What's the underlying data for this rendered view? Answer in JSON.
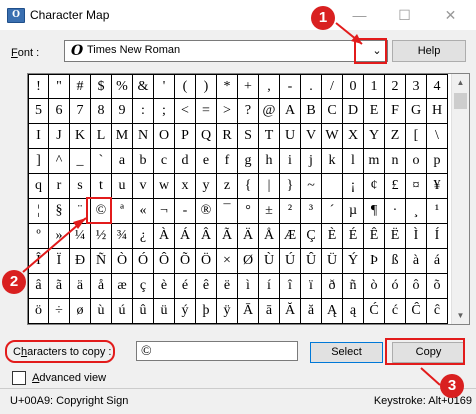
{
  "window": {
    "title": "Character Map",
    "icon": "character-map-app-icon",
    "minimize_glyph": "—",
    "maximize_glyph": "☐",
    "close_glyph": "✕"
  },
  "font": {
    "label": "Font :",
    "icon": "opentype-o-icon",
    "icon_glyph": "O",
    "value": "Times New Roman",
    "help_label": "Help"
  },
  "grid": {
    "rows": [
      [
        "!",
        "\"",
        "#",
        "$",
        "%",
        "&",
        "'",
        "(",
        ")",
        "*",
        "+",
        ",",
        "-",
        ".",
        "/",
        "0",
        "1",
        "2",
        "3",
        "4"
      ],
      [
        "5",
        "6",
        "7",
        "8",
        "9",
        ":",
        ";",
        "<",
        "=",
        ">",
        "?",
        "@",
        "A",
        "B",
        "C",
        "D",
        "E",
        "F",
        "G",
        "H"
      ],
      [
        "I",
        "J",
        "K",
        "L",
        "M",
        "N",
        "O",
        "P",
        "Q",
        "R",
        "S",
        "T",
        "U",
        "V",
        "W",
        "X",
        "Y",
        "Z",
        "[",
        "\\"
      ],
      [
        "]",
        "^",
        "_",
        "`",
        "a",
        "b",
        "c",
        "d",
        "e",
        "f",
        "g",
        "h",
        "i",
        "j",
        "k",
        "l",
        "m",
        "n",
        "o",
        "p"
      ],
      [
        "q",
        "r",
        "s",
        "t",
        "u",
        "v",
        "w",
        "x",
        "y",
        "z",
        "{",
        "|",
        "}",
        "~",
        " ",
        "¡",
        "¢",
        "£",
        "¤",
        "¥"
      ],
      [
        "¦",
        "§",
        "¨",
        "©",
        "ª",
        "«",
        "¬",
        "-",
        "®",
        "¯",
        "°",
        "±",
        "²",
        "³",
        "´",
        "µ",
        "¶",
        "·",
        "¸",
        "¹"
      ],
      [
        "º",
        "»",
        "¼",
        "½",
        "¾",
        "¿",
        "À",
        "Á",
        "Â",
        "Ã",
        "Ä",
        "Å",
        "Æ",
        "Ç",
        "È",
        "É",
        "Ê",
        "Ë",
        "Ì",
        "Í"
      ],
      [
        "Î",
        "Ï",
        "Ð",
        "Ñ",
        "Ò",
        "Ó",
        "Ô",
        "Õ",
        "Ö",
        "×",
        "Ø",
        "Ù",
        "Ú",
        "Û",
        "Ü",
        "Ý",
        "Þ",
        "ß",
        "à",
        "á"
      ],
      [
        "â",
        "ã",
        "ä",
        "å",
        "æ",
        "ç",
        "è",
        "é",
        "ê",
        "ë",
        "ì",
        "í",
        "î",
        "ï",
        "ð",
        "ñ",
        "ò",
        "ó",
        "ô",
        "õ"
      ],
      [
        "ö",
        "÷",
        "ø",
        "ù",
        "ú",
        "û",
        "ü",
        "ý",
        "þ",
        "ÿ",
        "Ā",
        "ā",
        "Ă",
        "ă",
        "Ą",
        "ą",
        "Ć",
        "ć",
        "Ĉ",
        "ĉ"
      ]
    ],
    "selected_char": "©"
  },
  "copy": {
    "label": "Characters to copy :",
    "value": "©",
    "select_label": "Select",
    "copy_label": "Copy"
  },
  "advanced": {
    "label": "Advanced view",
    "checked": false
  },
  "status": {
    "left": "U+00A9: Copyright Sign",
    "right": "Keystroke: Alt+0169"
  },
  "annotations": [
    {
      "number": "1",
      "target": "font-dropdown-arrow"
    },
    {
      "number": "2",
      "target": "copyright-cell"
    },
    {
      "number": "3",
      "target": "copy-button"
    }
  ],
  "colors": {
    "annotation_red": "#d92020",
    "select_border": "#0078d7"
  }
}
